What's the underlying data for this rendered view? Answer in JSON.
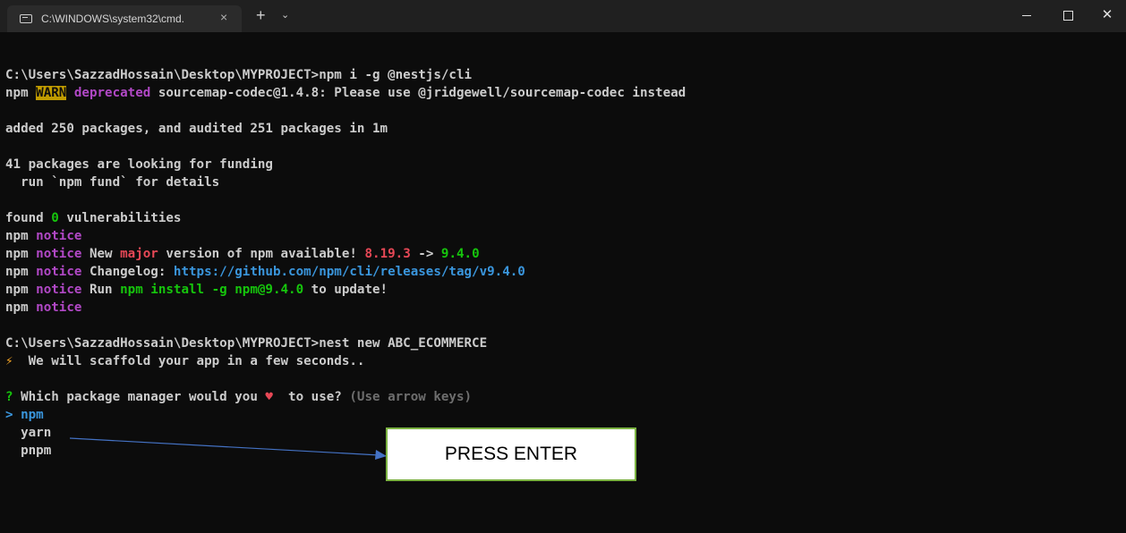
{
  "window": {
    "tab_title": "C:\\WINDOWS\\system32\\cmd.",
    "tab_close": "×",
    "new_tab": "+",
    "dropdown": "⌄",
    "close_glyph": "✕"
  },
  "terminal": {
    "l1": "C:\\Users\\SazzadHossain\\Desktop\\MYPROJECT>npm i -g @nestjs/cli",
    "l2_npm": "npm ",
    "l2_warn": "WARN",
    "l2_dep": " deprecated",
    "l2_rest": " sourcemap-codec@1.4.8: Please use @jridgewell/sourcemap-codec instead",
    "l3": "added 250 packages, and audited 251 packages in 1m",
    "l4": "41 packages are looking for funding",
    "l5": "  run `npm fund` for details",
    "l6_a": "found ",
    "l6_zero": "0",
    "l6_b": " vulnerabilities",
    "notice_npm": "npm ",
    "notice": "notice",
    "l8_a": " New ",
    "l8_major": "major",
    "l8_b": " version of npm available! ",
    "l8_old": "8.19.3",
    "l8_arrow": " -> ",
    "l8_new": "9.4.0",
    "l9_a": " Changelog: ",
    "l9_link": "https://github.com/npm/cli/releases/tag/v9.4.0",
    "l10_a": " Run ",
    "l10_cmd": "npm install -g npm@9.4.0",
    "l10_b": " to update!",
    "l12": "C:\\Users\\SazzadHossain\\Desktop\\MYPROJECT>nest new ABC_ECOMMERCE",
    "l13_icon": "⚡",
    "l13": "  We will scaffold your app in a few seconds..",
    "l15_q": "?",
    "l15_a": " Which package manager would you ",
    "l15_heart": "♥",
    "l15_b": "  to use? ",
    "l15_hint": "(Use arrow keys)",
    "pointer": ">",
    "opt1": " npm",
    "opt2": "  yarn",
    "opt3": "  pnpm"
  },
  "annotation": {
    "label": "PRESS ENTER",
    "arrow_color": "#4472c4",
    "box_border": "#7cb342"
  }
}
